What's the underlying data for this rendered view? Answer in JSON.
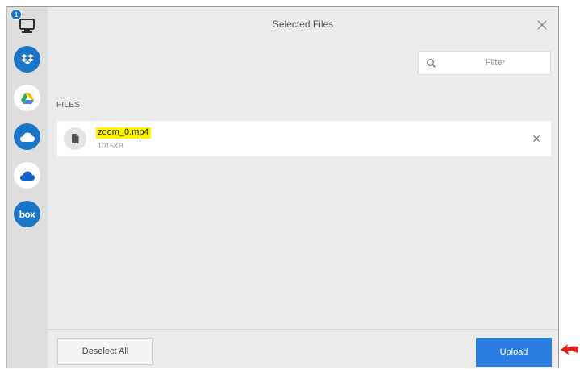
{
  "dialog": {
    "title": "Selected Files"
  },
  "sidebar": {
    "notification_count": "1",
    "items": [
      {
        "name": "computer",
        "icon": "monitor-icon"
      },
      {
        "name": "dropbox",
        "icon": "dropbox-icon"
      },
      {
        "name": "google-drive",
        "icon": "google-drive-icon"
      },
      {
        "name": "onedrive",
        "icon": "onedrive-icon"
      },
      {
        "name": "onedrive-business",
        "icon": "onedrive-icon"
      },
      {
        "name": "box",
        "icon": "box-icon",
        "label": "box"
      }
    ]
  },
  "filter": {
    "placeholder": "Filter"
  },
  "files": {
    "heading": "FILES",
    "items": [
      {
        "name": "zoom_0.mp4",
        "size": "1015KB"
      }
    ]
  },
  "footer": {
    "deselect_label": "Deselect All",
    "upload_label": "Upload"
  },
  "colors": {
    "accent": "#2a7de1",
    "sidebar_bg": "#dedede",
    "panel_bg": "#ebebeb",
    "highlight": "#fff200",
    "annotation": "#e02020"
  }
}
